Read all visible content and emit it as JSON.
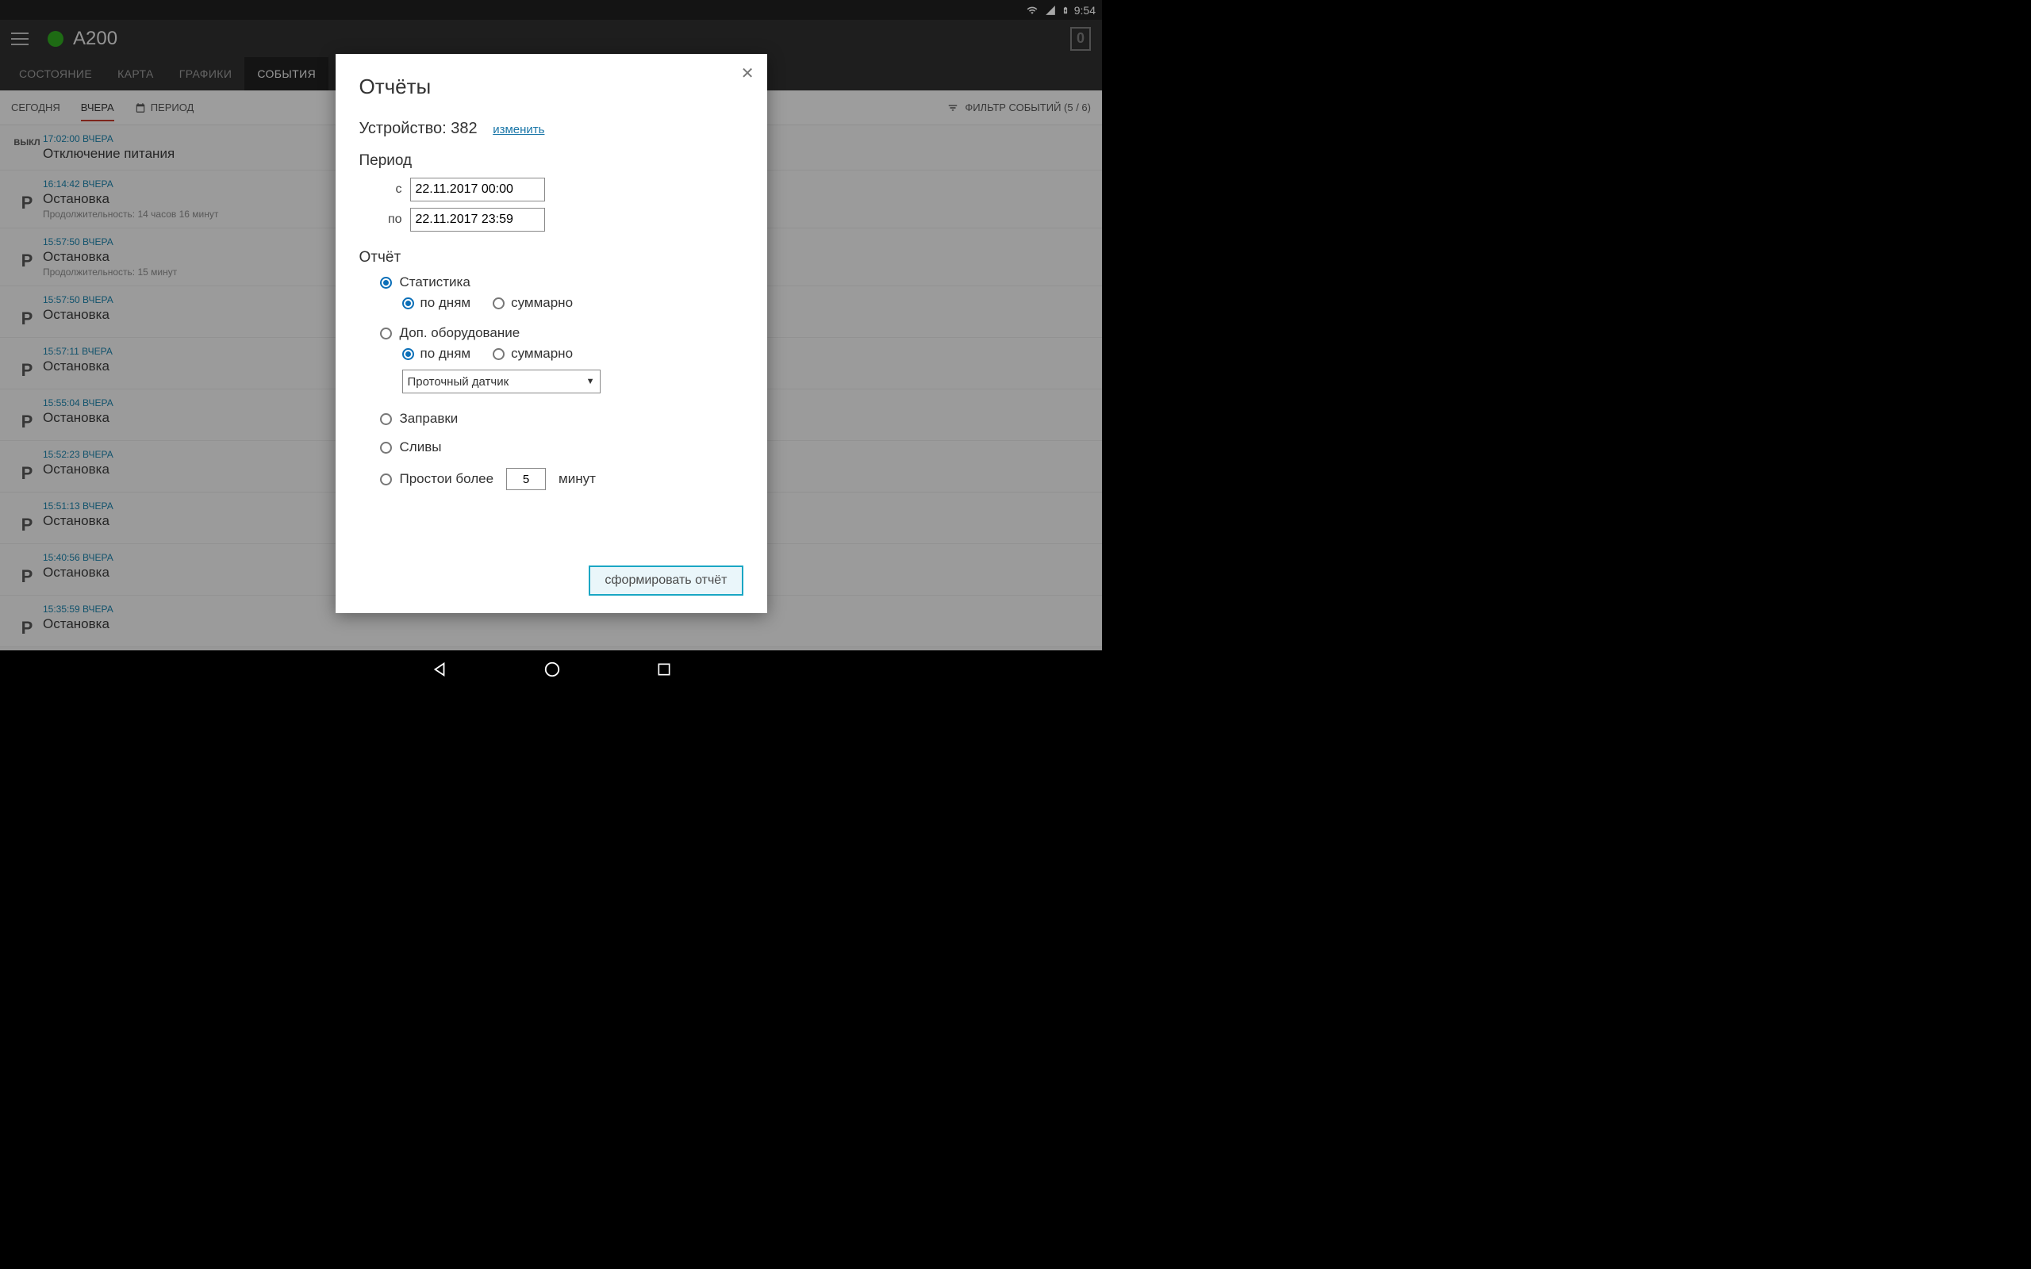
{
  "statusbar": {
    "time": "9:54"
  },
  "header": {
    "device_title": "A200",
    "counter": "0"
  },
  "tabs": {
    "state": "СОСТОЯНИЕ",
    "map": "КАРТА",
    "charts": "ГРАФИКИ",
    "events": "СОБЫТИЯ"
  },
  "subbar": {
    "today": "СЕГОДНЯ",
    "yesterday": "ВЧЕРА",
    "period": "ПЕРИОД",
    "filter_label": "ФИЛЬТР СОБЫТИЙ (5 / 6)"
  },
  "events": [
    {
      "icon": "ВЫКЛ",
      "icon_small": true,
      "time": "17:02:00 ВЧЕРА",
      "title": "Отключение питания",
      "sub": ""
    },
    {
      "icon": "P",
      "time": "16:14:42 ВЧЕРА",
      "title": "Остановка",
      "sub": "Продолжительность: 14 часов 16 минут"
    },
    {
      "icon": "P",
      "time": "15:57:50 ВЧЕРА",
      "title": "Остановка",
      "sub": "Продолжительность: 15 минут"
    },
    {
      "icon": "P",
      "time": "15:57:50 ВЧЕРА",
      "title": "Остановка",
      "sub": ""
    },
    {
      "icon": "P",
      "time": "15:57:11 ВЧЕРА",
      "title": "Остановка",
      "sub": ""
    },
    {
      "icon": "P",
      "time": "15:55:04 ВЧЕРА",
      "title": "Остановка",
      "sub": ""
    },
    {
      "icon": "P",
      "time": "15:52:23 ВЧЕРА",
      "title": "Остановка",
      "sub": ""
    },
    {
      "icon": "P",
      "time": "15:51:13 ВЧЕРА",
      "title": "Остановка",
      "sub": ""
    },
    {
      "icon": "P",
      "time": "15:40:56 ВЧЕРА",
      "title": "Остановка",
      "sub": ""
    },
    {
      "icon": "P",
      "time": "15:35:59 ВЧЕРА",
      "title": "Остановка",
      "sub": ""
    }
  ],
  "modal": {
    "title": "Отчёты",
    "device_label": "Устройство: 382",
    "change_link": "изменить",
    "period_label": "Период",
    "from_label": "с",
    "from_value": "22.11.2017 00:00",
    "to_label": "по",
    "to_value": "22.11.2017 23:59",
    "report_label": "Отчёт",
    "opt_stats": "Статистика",
    "opt_by_day": "по дням",
    "opt_summary": "суммарно",
    "opt_equip": "Доп. оборудование",
    "sensor_selected": "Проточный датчик",
    "opt_refuel": "Заправки",
    "opt_drain": "Сливы",
    "opt_idle_prefix": "Простои более",
    "opt_idle_value": "5",
    "opt_idle_suffix": "минут",
    "submit": "сформировать отчёт"
  }
}
